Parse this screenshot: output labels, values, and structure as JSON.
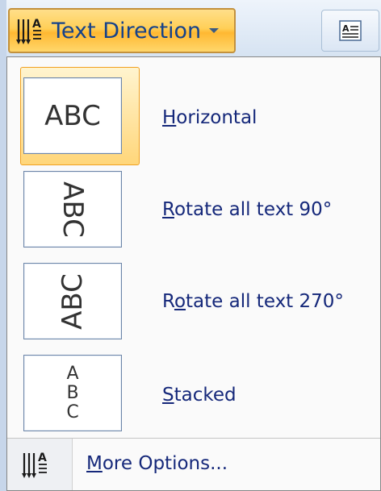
{
  "toolbar": {
    "text_direction_label": "Text Direction",
    "icon": "text-direction-icon",
    "side_button_icon": "text-box-icon"
  },
  "menu": {
    "items": [
      {
        "label_pre": "",
        "mnemonic": "H",
        "label_post": "orizontal",
        "thumb_text": "ABC",
        "selected": true
      },
      {
        "label_pre": "",
        "mnemonic": "R",
        "label_post": "otate all text 90°",
        "thumb_text": "ABC",
        "selected": false
      },
      {
        "label_pre": "R",
        "mnemonic": "o",
        "label_post": "tate all text 270°",
        "thumb_text": "ABC",
        "selected": false
      },
      {
        "label_pre": "",
        "mnemonic": "S",
        "label_post": "tacked",
        "thumb_letters": [
          "A",
          "B",
          "C"
        ],
        "selected": false
      }
    ],
    "more_options": {
      "label_pre": "",
      "mnemonic": "M",
      "label_post": "ore Options...",
      "icon": "text-direction-icon"
    }
  },
  "colors": {
    "accent_hot": "#ffcf57",
    "menu_text": "#15287a",
    "ribbon_text": "#15428b"
  }
}
